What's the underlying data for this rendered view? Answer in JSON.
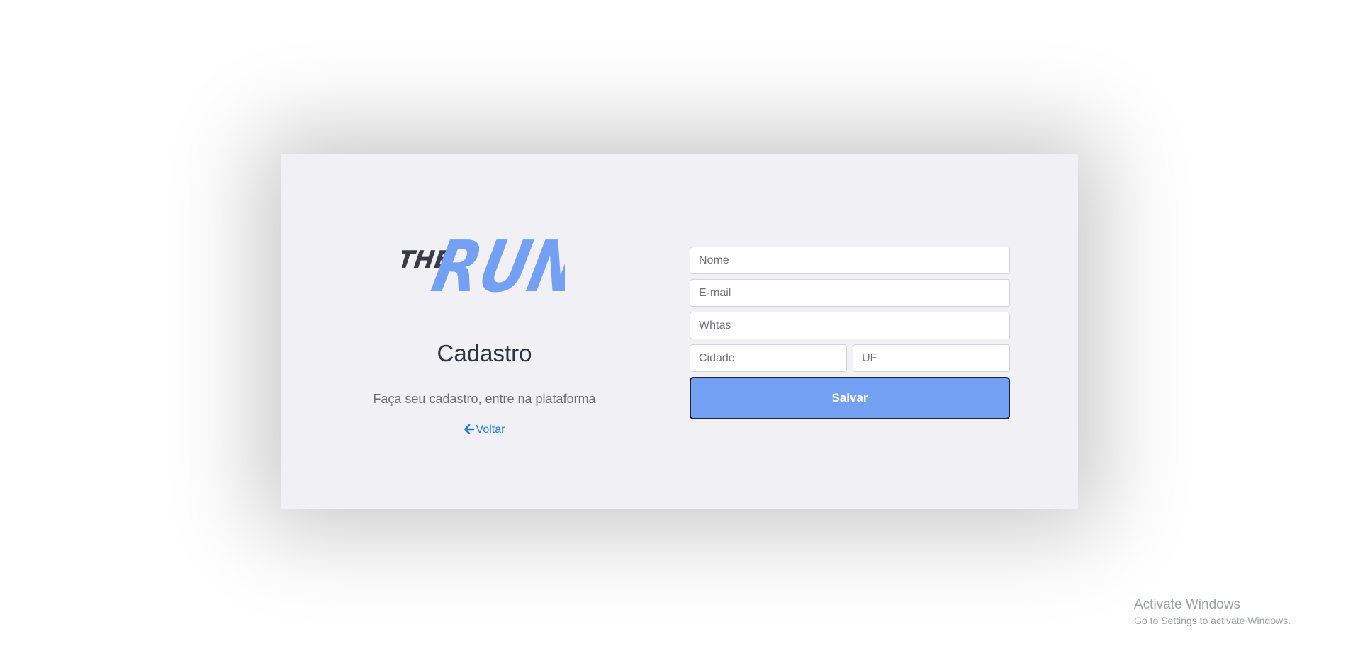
{
  "brand": {
    "logo_text_small": "THE",
    "logo_text_large": "RUN",
    "logo_colors": {
      "small": "#3a3a48",
      "large": "#73a0f2"
    }
  },
  "left_panel": {
    "title": "Cadastro",
    "subtitle": "Faça seu cadastro, entre na plataforma",
    "back_link": {
      "label": "Voltar",
      "icon": "arrow-left-icon",
      "color": "#1f7ae0"
    }
  },
  "form": {
    "name_field": {
      "placeholder": "Nome",
      "value": ""
    },
    "email_field": {
      "placeholder": "E-mail",
      "value": ""
    },
    "whatsapp_field": {
      "placeholder": "Whtas",
      "value": ""
    },
    "city_field": {
      "placeholder": "Cidade",
      "value": ""
    },
    "state_field": {
      "placeholder": "UF",
      "value": ""
    },
    "submit_label": "Salvar",
    "submit_color": "#73a0f2"
  },
  "windows_watermark": {
    "line1": "Activate Windows",
    "line2": "Go to Settings to activate Windows."
  }
}
